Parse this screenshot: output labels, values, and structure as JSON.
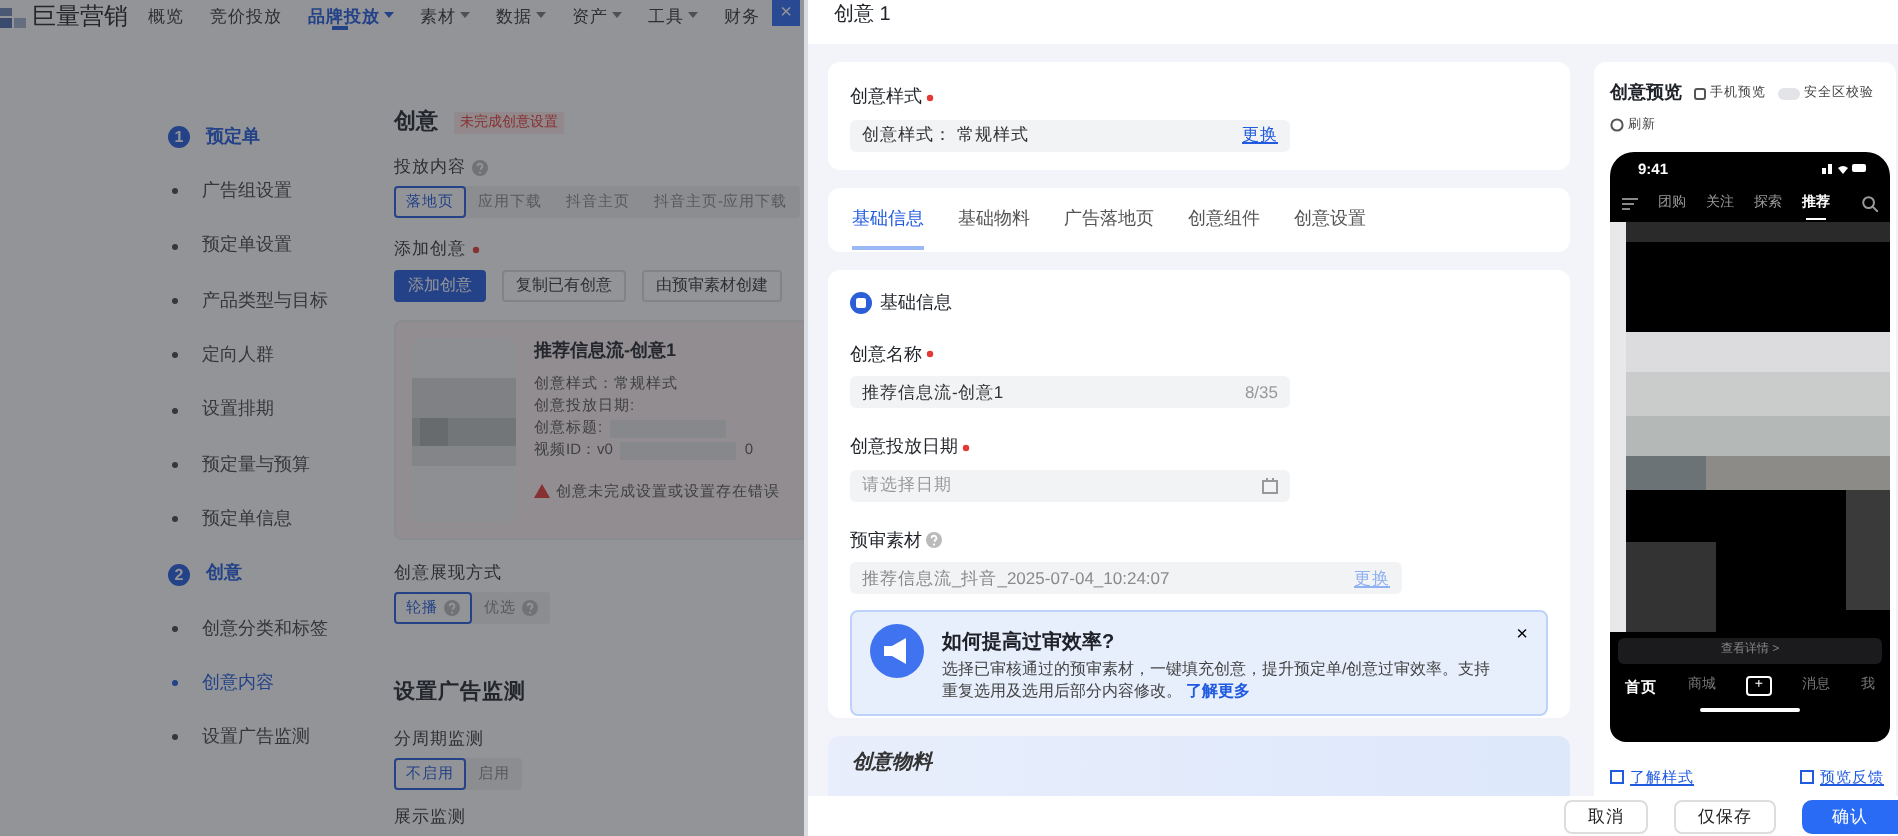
{
  "backdrop_page": {
    "logo": "巨量营销",
    "nav": [
      {
        "label": "概览",
        "selected": false,
        "dropdown": false
      },
      {
        "label": "竞价投放",
        "selected": false,
        "dropdown": false
      },
      {
        "label": "品牌投放",
        "selected": true,
        "dropdown": true
      },
      {
        "label": "素材",
        "selected": false,
        "dropdown": true
      },
      {
        "label": "数据",
        "selected": false,
        "dropdown": true
      },
      {
        "label": "资产",
        "selected": false,
        "dropdown": true
      },
      {
        "label": "工具",
        "selected": false,
        "dropdown": true
      },
      {
        "label": "财务",
        "selected": false,
        "dropdown": false
      }
    ],
    "close_button": "×",
    "steps": [
      {
        "number": "1",
        "label": "预定单",
        "items": [
          {
            "label": "广告组设置",
            "selected": false
          },
          {
            "label": "预定单设置",
            "selected": false
          },
          {
            "label": "产品类型与目标",
            "selected": false
          },
          {
            "label": "定向人群",
            "selected": false
          },
          {
            "label": "设置排期",
            "selected": false
          },
          {
            "label": "预定量与预算",
            "selected": false
          },
          {
            "label": "预定单信息",
            "selected": false
          }
        ]
      },
      {
        "number": "2",
        "label": "创意",
        "items": [
          {
            "label": "创意分类和标签",
            "selected": false
          },
          {
            "label": "创意内容",
            "selected": true
          },
          {
            "label": "设置广告监测",
            "selected": false
          }
        ]
      }
    ],
    "section_title": "创意",
    "section_tag": "未完成创意设置",
    "delivery_content": {
      "label": "投放内容",
      "help": true,
      "options": [
        {
          "label": "落地页",
          "selected": true
        },
        {
          "label": "应用下载",
          "selected": false
        },
        {
          "label": "抖音主页",
          "selected": false
        },
        {
          "label": "抖音主页-应用下载",
          "selected": false
        }
      ]
    },
    "add_creative": {
      "label": "添加创意",
      "required": true,
      "buttons": [
        {
          "label": "添加创意",
          "kind": "primary"
        },
        {
          "label": "复制已有创意",
          "kind": "default"
        },
        {
          "label": "由预审素材创建",
          "kind": "default"
        }
      ]
    },
    "creative_card": {
      "title": "推荐信息流-创意1",
      "lines": [
        "创意样式：常规样式",
        "创意投放日期:",
        "创意标题:",
        "视频ID：v0"
      ],
      "trailing": "0",
      "warning": "创意未完成设置或设置存在错误"
    },
    "display_mode": {
      "label": "创意展现方式",
      "options": [
        {
          "label": "轮播",
          "selected": true,
          "help": true
        },
        {
          "label": "优选",
          "selected": false,
          "help": true
        }
      ]
    },
    "monitoring": {
      "title": "设置广告监测",
      "period_label": "分周期监测",
      "options": [
        {
          "label": "不启用",
          "selected": true
        },
        {
          "label": "启用",
          "selected": false
        }
      ],
      "display_label": "展示监测"
    }
  },
  "drawer": {
    "title": "创意 1",
    "style_card": {
      "label": "创意样式",
      "required": true,
      "field_label": "创意样式：",
      "value": "常规样式",
      "action": "更换"
    },
    "tabs": [
      {
        "label": "基础信息",
        "selected": true
      },
      {
        "label": "基础物料",
        "selected": false
      },
      {
        "label": "广告落地页",
        "selected": false
      },
      {
        "label": "创意组件",
        "selected": false
      },
      {
        "label": "创意设置",
        "selected": false
      }
    ],
    "basic_info": {
      "title": "基础信息",
      "fields": [
        {
          "kind": "text",
          "label": "创意名称",
          "required": true,
          "help": false,
          "value": "推荐信息流-创意1",
          "counter": "8/35"
        },
        {
          "kind": "date",
          "label": "创意投放日期",
          "required": true,
          "help": false,
          "placeholder": "请选择日期"
        },
        {
          "kind": "material",
          "label": "预审素材",
          "required": false,
          "help": true,
          "value": "推荐信息流_抖音_2025-07-04_10:24:07",
          "action": "更换"
        }
      ],
      "tip": {
        "title": "如何提高过审效率?",
        "text": "选择已审核通过的预审素材，一键填充创意，提升预定单/创意过审效率。支持重复选用及选用后部分内容修改。",
        "link": "了解更多",
        "close": "×"
      }
    },
    "material_title": "创意物料",
    "preview": {
      "title": "创意预览",
      "phone_preview": "手机预览",
      "safe_area": {
        "label": "安全区校验",
        "on": false
      },
      "refresh": "刷新",
      "phone": {
        "time": "9:41",
        "tabs": [
          {
            "label": "团购",
            "selected": false
          },
          {
            "label": "关注",
            "selected": false
          },
          {
            "label": "探索",
            "selected": false
          },
          {
            "label": "推荐",
            "selected": true
          }
        ],
        "cta": "查看详情 >",
        "nav": [
          {
            "kind": "tab",
            "label": "首页",
            "selected": true
          },
          {
            "kind": "tab",
            "label": "商城",
            "selected": false
          },
          {
            "kind": "plus",
            "label": "+"
          },
          {
            "kind": "tab",
            "label": "消息",
            "selected": false
          },
          {
            "kind": "tab",
            "label": "我",
            "selected": false
          }
        ]
      },
      "links": [
        "了解样式",
        "预览反馈"
      ]
    },
    "footer": [
      {
        "label": "取消",
        "kind": "default"
      },
      {
        "label": "仅保存",
        "kind": "default"
      },
      {
        "label": "确认",
        "kind": "primary"
      }
    ]
  }
}
